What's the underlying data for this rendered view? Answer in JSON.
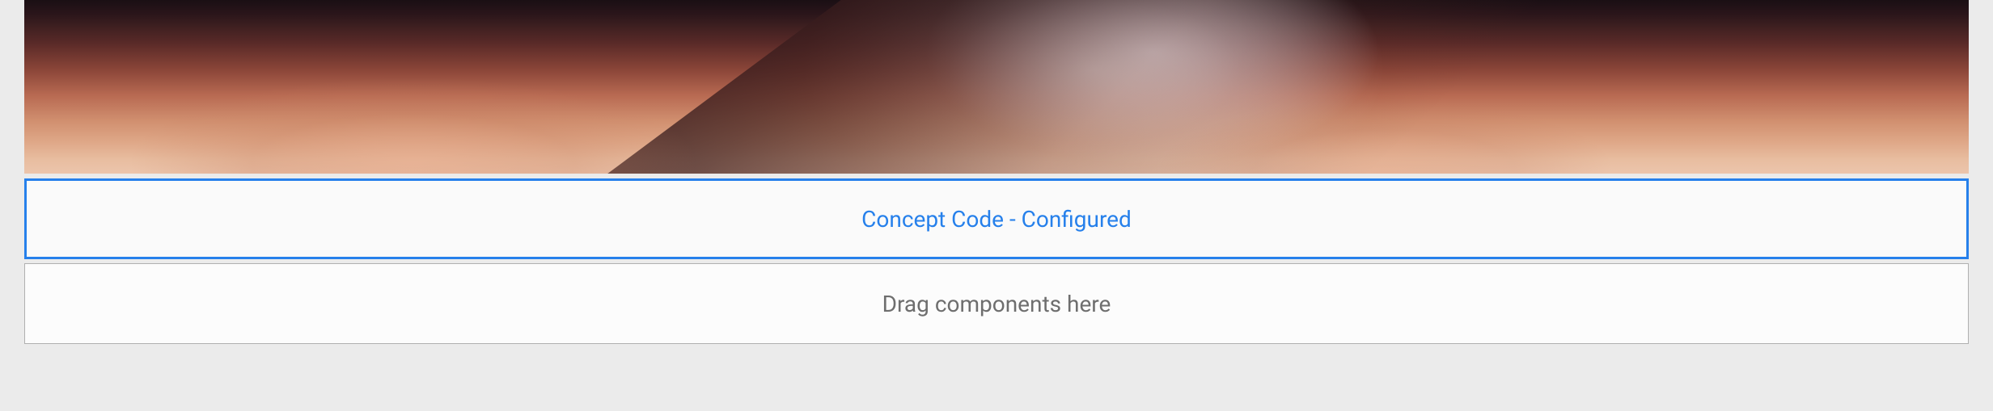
{
  "components": {
    "selected": {
      "label": "Concept Code - Configured"
    },
    "dropzone": {
      "placeholder": "Drag components here"
    }
  }
}
